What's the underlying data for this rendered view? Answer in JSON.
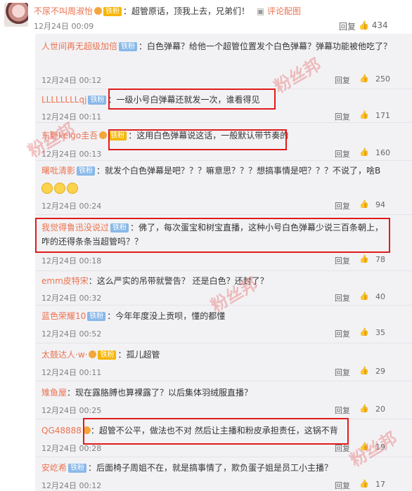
{
  "top_comment": {
    "user": "不尿不叫周淑怡",
    "badge": "铁粉",
    "text": "：超管原话，顶我上去，兄弟们！",
    "extra_link": "评论配图",
    "time": "12月24日 00:09",
    "reply_label": "回复",
    "likes": "434"
  },
  "replies": [
    {
      "user": "人世间再无超级加倍",
      "badge": "铁粉",
      "text": "：白色弹幕？给他一个超管位置发个白色弹幕？弹幕功能被他吃了？",
      "time": "12月24日 00:12",
      "reply_label": "回复",
      "likes": "250"
    },
    {
      "user": "LLLLLLLLqj",
      "badge": "铁粉",
      "text": "：一级小号白弹幕还就发一次，谁看得见",
      "time": "12月24日 00:11",
      "reply_label": "回复",
      "likes": "171"
    },
    {
      "user": "东野keigo圭吾",
      "badge": "铁粉",
      "text": "：这用白色弹幕说这话，一般默认带节奏的",
      "time": "12月24日 00:13",
      "reply_label": "回复",
      "likes": "160"
    },
    {
      "user": "曙吡清影",
      "badge": "铁粉",
      "text": "：就发个白色弹幕是吧？？？嘛意思？？？想搞事情是吧？？？不说了，啥B",
      "time": "12月24日 00:24",
      "reply_label": "回复",
      "likes": "94"
    },
    {
      "user": "我觉得鲁迅没说过",
      "badge": "铁粉",
      "text": "：佛了，每次蛋宝和树宝直播，这种小号白色弹幕少说三百条朝上，咋的还得条条当超管吗？？",
      "time": "12月24日 00:18",
      "reply_label": "回复",
      "likes": "78"
    },
    {
      "user": "emm皮特宋",
      "badge": "",
      "text": "：这么严实的吊带就警告？ 还是白色？还封了？",
      "time": "12月24日 00:32",
      "reply_label": "回复",
      "likes": "40"
    },
    {
      "user": "蓝色荣耀10",
      "badge": "铁粉",
      "text": "：今年年度没上贡呗，懂的都懂",
      "time": "12月24日 00:52",
      "reply_label": "回复",
      "likes": "35"
    },
    {
      "user": "太鼓达人·w·",
      "badge": "铁粉",
      "text": "：孤儿超管",
      "time": "12月24日 00:11",
      "reply_label": "回复",
      "likes": "29"
    },
    {
      "user": "雉鱼屋",
      "badge": "",
      "text": "：现在露胳膊也算裸露了？以后集体羽绒服直播？",
      "time": "12月24日 00:25",
      "reply_label": "回复",
      "likes": "20"
    },
    {
      "user": "QG48888",
      "badge": "",
      "text": "：超管不公平，做法也不对 然后让主播和粉皮承担责任，这锅不背",
      "time": "12月24日 00:28",
      "reply_label": "回复",
      "likes": "19"
    },
    {
      "user": "安屹希",
      "badge": "铁粉",
      "text": "：后面椅子周姐不在，就是搞事情了，欺负蛋子姐是员工小主播？",
      "time": "12月24日 00:12",
      "reply_label": "回复",
      "likes": "17"
    }
  ],
  "watermark": "粉丝邦",
  "colors": {
    "username": "#eb7350",
    "highlight": "#e11b1b",
    "badge": "#88b8e8"
  }
}
